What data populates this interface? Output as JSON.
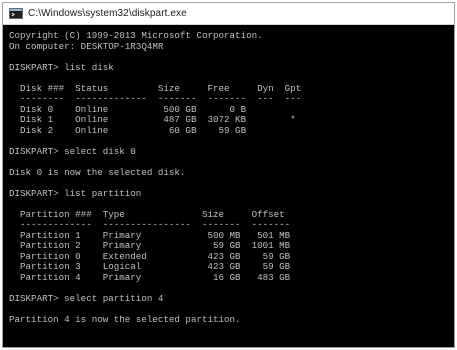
{
  "window": {
    "title": "C:\\Windows\\system32\\diskpart.exe",
    "icon": "console-app-icon"
  },
  "console": {
    "lines": [
      "Copyright (C) 1999-2013 Microsoft Corporation.",
      "On computer: DESKTOP-1R3Q4MR",
      "",
      "DISKPART> list disk",
      "",
      "  Disk ###  Status         Size     Free     Dyn  Gpt",
      "  --------  -------------  -------  -------  ---  ---",
      "  Disk 0    Online          500 GB      0 B",
      "  Disk 1    Online          487 GB  3072 KB        *",
      "  Disk 2    Online           60 GB    59 GB",
      "",
      "DISKPART> select disk 0",
      "",
      "Disk 0 is now the selected disk.",
      "",
      "DISKPART> list partition",
      "",
      "  Partition ###  Type              Size     Offset",
      "  -------------  ----------------  -------  -------",
      "  Partition 1    Primary            500 MB   501 MB",
      "  Partition 2    Primary             59 GB  1001 MB",
      "  Partition 0    Extended           423 GB    59 GB",
      "  Partition 3    Logical            423 GB    59 GB",
      "  Partition 4    Primary             16 GB   483 GB",
      "",
      "DISKPART> select partition 4",
      "",
      "Partition 4 is now the selected partition.",
      ""
    ]
  },
  "colors": {
    "console_background": "#000000",
    "console_text": "#c0c0c0",
    "titlebar_background": "#ffffff"
  }
}
